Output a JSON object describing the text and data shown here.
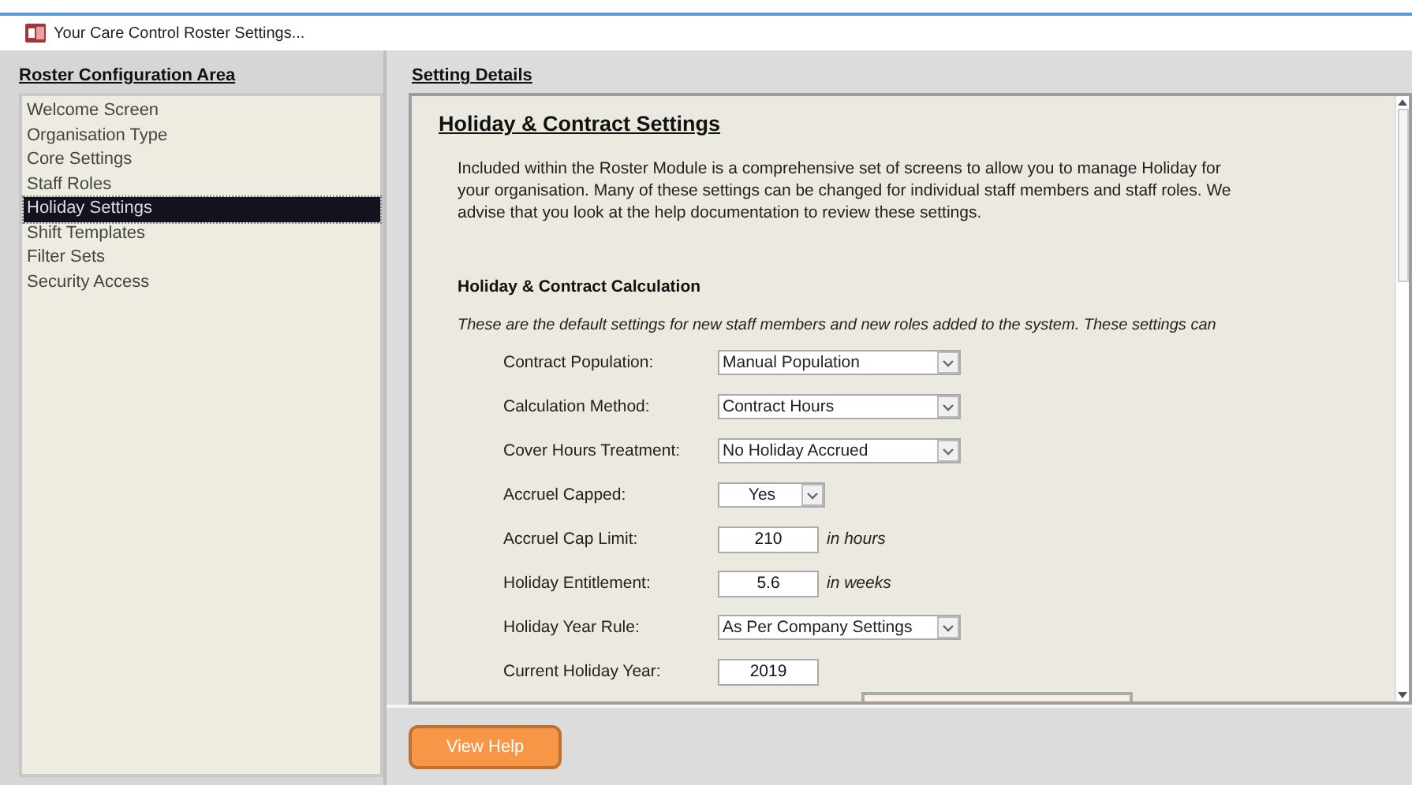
{
  "window": {
    "title": "Your Care Control Roster Settings..."
  },
  "sidebar": {
    "heading": "Roster Configuration Area",
    "items": [
      {
        "label": "Welcome Screen",
        "selected": false
      },
      {
        "label": "Organisation Type",
        "selected": false
      },
      {
        "label": "Core Settings",
        "selected": false
      },
      {
        "label": "Staff Roles",
        "selected": false
      },
      {
        "label": "Holiday Settings",
        "selected": true
      },
      {
        "label": "Shift Templates",
        "selected": false
      },
      {
        "label": "Filter Sets",
        "selected": false
      },
      {
        "label": "Security Access",
        "selected": false
      }
    ]
  },
  "details": {
    "heading": "Setting Details",
    "title": "Holiday & Contract Settings",
    "intro": "Included within the Roster Module is a comprehensive set of screens to allow you to manage Holiday for your organisation.   Many of these settings can be changed for individual staff members and staff roles.  We advise that you look at the help documentation to review these settings.",
    "section": "Holiday & Contract Calculation",
    "note": "These are the default settings for new staff members and new roles added to the system.  These settings can",
    "fields": [
      {
        "label": "Contract Population:",
        "kind": "select",
        "value": "Manual Population"
      },
      {
        "label": "Calculation Method:",
        "kind": "select",
        "value": "Contract Hours"
      },
      {
        "label": "Cover Hours Treatment:",
        "kind": "select",
        "value": "No Holiday Accrued"
      },
      {
        "label": "Accruel Capped:",
        "kind": "small-select",
        "value": "Yes"
      },
      {
        "label": "Accruel Cap Limit:",
        "kind": "number",
        "value": "210",
        "unit": "in hours"
      },
      {
        "label": "Holiday Entitlement:",
        "kind": "number",
        "value": "5.6",
        "unit": "in weeks"
      },
      {
        "label": "Holiday Year Rule:",
        "kind": "select",
        "value": "As Per Company Settings"
      },
      {
        "label": "Current Holiday Year:",
        "kind": "number",
        "value": "2019"
      }
    ]
  },
  "buttons": [
    {
      "label": "View Help"
    }
  ]
}
